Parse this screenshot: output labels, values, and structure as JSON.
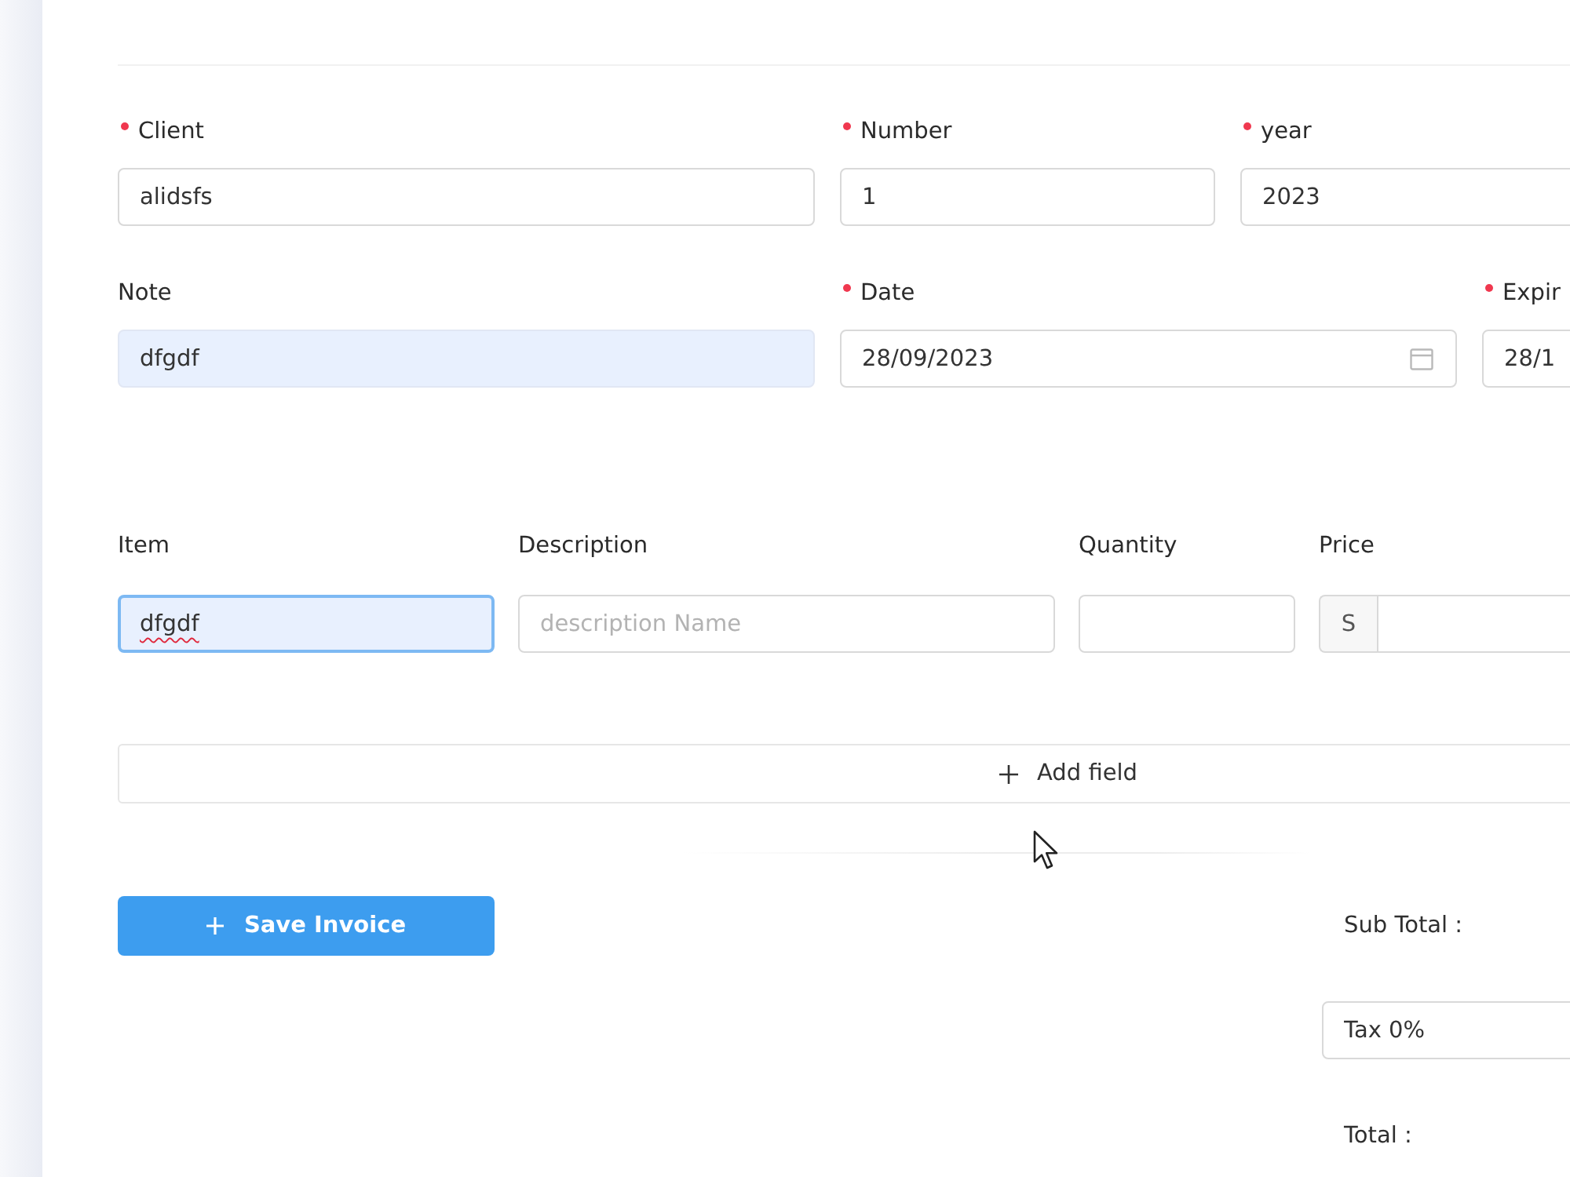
{
  "invoice_fields": [
    [
      {
        "label": "Client",
        "required": true,
        "kind": "text",
        "value": "alidsfs",
        "autofilled": false
      },
      {
        "label": "Number",
        "required": true,
        "kind": "text",
        "value": "1",
        "autofilled": false
      },
      {
        "label": "year",
        "required": true,
        "kind": "text",
        "value": "2023",
        "autofilled": false
      }
    ],
    [
      {
        "label": "Note",
        "required": false,
        "kind": "text",
        "value": "dfgdf",
        "autofilled": true
      },
      {
        "label": "Date",
        "required": true,
        "kind": "date",
        "value": "28/09/2023",
        "autofilled": false
      },
      {
        "label": "Expir",
        "required": true,
        "kind": "text",
        "value": "28/1",
        "autofilled": false
      }
    ]
  ],
  "items": {
    "columns": [
      "Item",
      "Description",
      "Quantity",
      "Price"
    ],
    "fields": [
      {
        "kind": "text",
        "value": "dfgdf",
        "focused": true,
        "misspelled": true
      },
      {
        "kind": "text",
        "placeholder": "description Name",
        "focused": false,
        "misspelled": false
      },
      {
        "kind": "text",
        "focused": false
      },
      {
        "kind": "money",
        "prefix": "S",
        "focused": false
      }
    ]
  },
  "add_field_button": {
    "label": "Add field"
  },
  "save_button": {
    "label": "Save Invoice"
  },
  "totals": {
    "sub_total_label": "Sub Total :",
    "tax_field": {
      "value": "Tax 0%"
    },
    "total_label": "Total :"
  }
}
